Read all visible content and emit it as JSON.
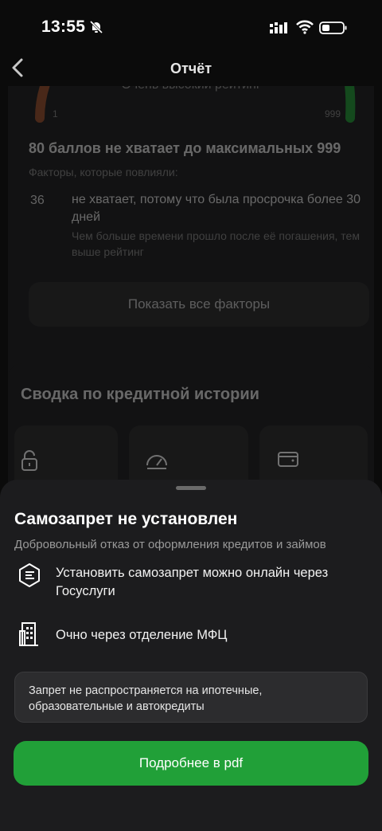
{
  "status_bar": {
    "time": "13:55"
  },
  "nav": {
    "title": "Отчёт"
  },
  "rating": {
    "label": "Очень высокий рейтинг",
    "min": "1",
    "max": "999",
    "headline": "80 баллов не хватает до максимальных 999",
    "factors_label": "Факторы, которые повлияли:",
    "factor": {
      "value": "36",
      "title": "не хватает, потому что была просрочка более 30 дней",
      "description": "Чем больше времени прошло после её погашения, тем выше рейтинг"
    },
    "show_all": "Показать все факторы"
  },
  "summary": {
    "title": "Сводка по кредитной истории"
  },
  "sheet": {
    "title": "Самозапрет не установлен",
    "subtitle": "Добровольный отказ от оформления кредитов и займов",
    "options": [
      {
        "icon": "gosuslugi-icon",
        "label": "Установить самозапрет можно онлайн через Госуслуги"
      },
      {
        "icon": "building-icon",
        "label": "Очно через отделение МФЦ"
      }
    ],
    "note": "Запрет не распространяется на ипотечные, образовательные и автокредиты",
    "button": "Подробнее в pdf"
  },
  "colors": {
    "accent": "#21a038",
    "sheet_bg": "#1c1c1e",
    "page_bg": "#0b0b0b"
  }
}
